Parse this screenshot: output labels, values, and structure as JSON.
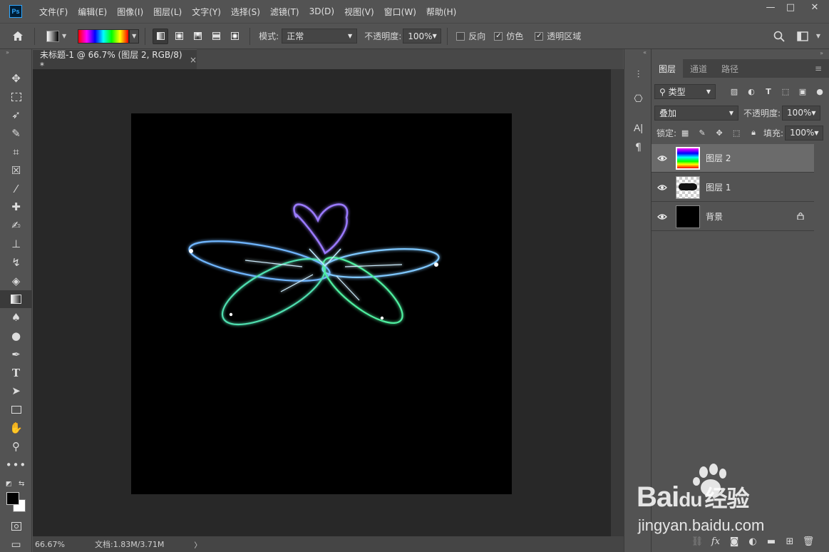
{
  "menubar": {
    "logo": "Ps",
    "items": [
      "文件(F)",
      "编辑(E)",
      "图像(I)",
      "图层(L)",
      "文字(Y)",
      "选择(S)",
      "滤镜(T)",
      "3D(D)",
      "视图(V)",
      "窗口(W)",
      "帮助(H)"
    ],
    "window_controls": [
      "—",
      "□",
      "✕"
    ]
  },
  "options": {
    "mode_label": "模式:",
    "mode_value": "正常",
    "opacity_label": "不透明度:",
    "opacity_value": "100%",
    "reverse_label": "反向",
    "reverse_checked": false,
    "dither_label": "仿色",
    "dither_checked": true,
    "transparency_label": "透明区域",
    "transparency_checked": true
  },
  "document": {
    "tab_title": "未标题-1 @ 66.7% (图层 2, RGB/8) *",
    "tab_close": "×"
  },
  "status": {
    "zoom": "66.67%",
    "doc_info": "文档:1.83M/3.71M",
    "arrow": "〉"
  },
  "layers_panel": {
    "tabs": [
      "图层",
      "通道",
      "路径"
    ],
    "filter_kind": "类型",
    "blend_mode": "叠加",
    "opacity_label": "不透明度:",
    "opacity_value": "100%",
    "lock_label": "锁定:",
    "fill_label": "填充:",
    "fill_value": "100%",
    "layers": [
      {
        "name": "图层 2",
        "selected": true,
        "thumb": "rainbow"
      },
      {
        "name": "图层 1",
        "selected": false,
        "thumb": "transparent"
      },
      {
        "name": "背景",
        "selected": false,
        "thumb": "black",
        "locked": true
      }
    ]
  },
  "watermark": {
    "brand": "Bai",
    "brand2": "du",
    "brand_cn": "经验",
    "url": "jingyan.baidu.com"
  }
}
